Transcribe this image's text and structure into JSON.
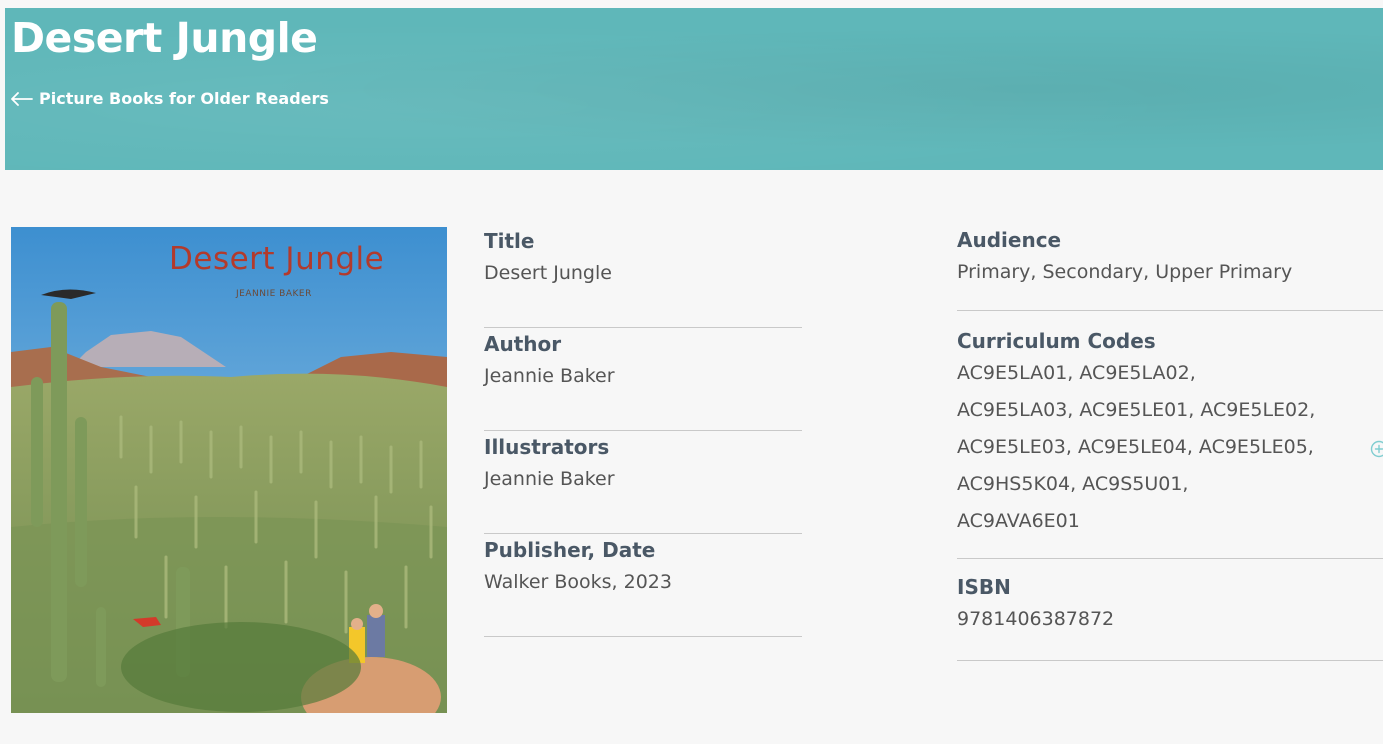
{
  "header": {
    "title": "Desert Jungle",
    "back_link_label": "Picture Books for Older Readers",
    "background_color": "#5fb7b9"
  },
  "cover": {
    "title_text": "Desert Jungle",
    "author_text": "JEANNIE BAKER"
  },
  "details": {
    "title": {
      "label": "Title",
      "value": "Desert Jungle"
    },
    "author": {
      "label": "Author",
      "value": "Jeannie Baker"
    },
    "illustrators": {
      "label": "Illustrators",
      "value": "Jeannie Baker"
    },
    "publisher": {
      "label": "Publisher, Date",
      "value": "Walker Books, 2023"
    },
    "audience": {
      "label": "Audience",
      "value": "Primary, Secondary, Upper Primary"
    },
    "curriculum": {
      "label": "Curriculum Codes",
      "lines": [
        "AC9E5LA01, AC9E5LA02,",
        "AC9E5LA03, AC9E5LE01, AC9E5LE02,",
        "AC9E5LE03, AC9E5LE04, AC9E5LE05,",
        "AC9HS5K04, AC9S5U01,",
        "AC9AVA6E01"
      ]
    },
    "isbn": {
      "label": "ISBN",
      "value": "9781406387872"
    }
  },
  "icons": {
    "back": "arrow-left-icon",
    "expand": "plus-circle-icon"
  }
}
